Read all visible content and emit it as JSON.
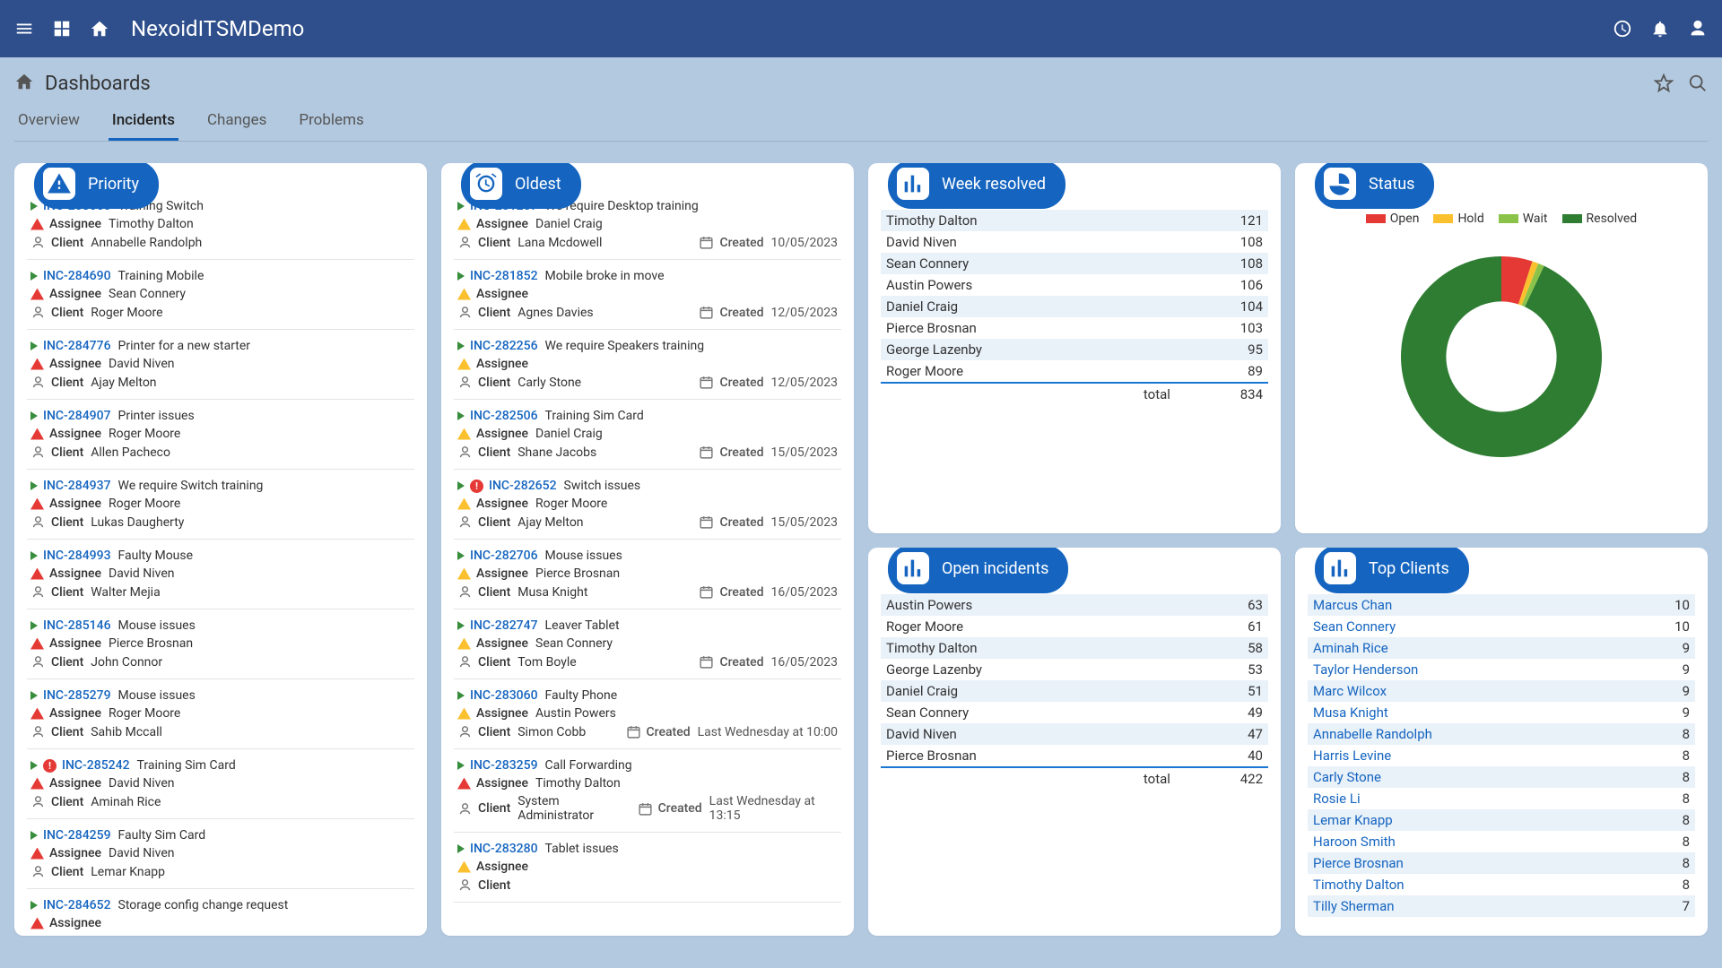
{
  "header": {
    "app_title": "NexoidITSMDemo"
  },
  "subheader": {
    "page_title": "Dashboards"
  },
  "tabs": [
    {
      "label": "Overview",
      "active": false
    },
    {
      "label": "Incidents",
      "active": true
    },
    {
      "label": "Changes",
      "active": false
    },
    {
      "label": "Problems",
      "active": false
    }
  ],
  "cards": {
    "priority": {
      "title": "Priority",
      "items": [
        {
          "id": "INC-283650",
          "title": "Training Switch",
          "assignee": "Timothy Dalton",
          "assignee_sev": "red",
          "client": "Annabelle Randolph"
        },
        {
          "id": "INC-284690",
          "title": "Training Mobile",
          "assignee": "Sean Connery",
          "assignee_sev": "red",
          "client": "Roger Moore"
        },
        {
          "id": "INC-284776",
          "title": "Printer for a new starter",
          "assignee": "David Niven",
          "assignee_sev": "red",
          "client": "Ajay Melton"
        },
        {
          "id": "INC-284907",
          "title": "Printer issues",
          "assignee": "Roger Moore",
          "assignee_sev": "red",
          "client": "Allen Pacheco"
        },
        {
          "id": "INC-284937",
          "title": "We require Switch training",
          "assignee": "Roger Moore",
          "assignee_sev": "red",
          "client": "Lukas Daugherty"
        },
        {
          "id": "INC-284993",
          "title": "Faulty Mouse",
          "assignee": "David Niven",
          "assignee_sev": "red",
          "client": "Walter Mejia"
        },
        {
          "id": "INC-285146",
          "title": "Mouse issues",
          "assignee": "Pierce  Brosnan",
          "assignee_sev": "red",
          "client": "John Connor"
        },
        {
          "id": "INC-285279",
          "title": "Mouse issues",
          "assignee": "Roger Moore",
          "assignee_sev": "red",
          "client": "Sahib Mccall"
        },
        {
          "id": "INC-285242",
          "title": "Training Sim Card",
          "flag": true,
          "assignee": "David Niven",
          "assignee_sev": "red",
          "client": "Aminah Rice"
        },
        {
          "id": "INC-284259",
          "title": "Faulty Sim Card",
          "assignee": "David Niven",
          "assignee_sev": "red",
          "client": "Lemar Knapp"
        },
        {
          "id": "INC-284652",
          "title": "Storage config change request",
          "assignee": "",
          "assignee_sev": "red",
          "client": ""
        }
      ]
    },
    "oldest": {
      "title": "Oldest",
      "created_label": "Created",
      "items": [
        {
          "id": "INC-281287",
          "title": "We require Desktop training",
          "assignee": "Daniel Craig",
          "assignee_sev": "amber",
          "client": "Lana Mcdowell",
          "created": "10/05/2023"
        },
        {
          "id": "INC-281852",
          "title": "Mobile broke in move",
          "assignee": "",
          "assignee_sev": "amber",
          "client": "Agnes Davies",
          "created": "12/05/2023"
        },
        {
          "id": "INC-282256",
          "title": "We require Speakers training",
          "assignee": "",
          "assignee_sev": "amber",
          "client": "Carly Stone",
          "created": "12/05/2023"
        },
        {
          "id": "INC-282506",
          "title": "Training Sim Card",
          "assignee": "Daniel Craig",
          "assignee_sev": "amber",
          "client": "Shane Jacobs",
          "created": "15/05/2023"
        },
        {
          "id": "INC-282652",
          "title": "Switch issues",
          "flag": true,
          "assignee": "Roger Moore",
          "assignee_sev": "amber",
          "client": "Ajay Melton",
          "created": "15/05/2023"
        },
        {
          "id": "INC-282706",
          "title": "Mouse issues",
          "assignee": "Pierce  Brosnan",
          "assignee_sev": "amber",
          "client": "Musa Knight",
          "created": "16/05/2023"
        },
        {
          "id": "INC-282747",
          "title": "Leaver Tablet",
          "assignee": "Sean Connery",
          "assignee_sev": "amber",
          "client": "Tom Boyle",
          "created": "16/05/2023"
        },
        {
          "id": "INC-283060",
          "title": "Faulty Phone",
          "assignee": "Austin Powers",
          "assignee_sev": "amber",
          "client": "Simon Cobb",
          "created": "Last Wednesday at 10:00"
        },
        {
          "id": "INC-283259",
          "title": "Call Forwarding",
          "assignee": "Timothy Dalton",
          "assignee_sev": "red",
          "client": "System Administrator",
          "created": "Last Wednesday at 13:15"
        },
        {
          "id": "INC-283280",
          "title": "Tablet issues",
          "assignee": "",
          "assignee_sev": "amber",
          "client": "",
          "created": ""
        }
      ]
    },
    "week_resolved": {
      "title": "Week resolved",
      "rows": [
        {
          "name": "Timothy Dalton",
          "value": 121
        },
        {
          "name": "David Niven",
          "value": 108
        },
        {
          "name": "Sean Connery",
          "value": 108
        },
        {
          "name": "Austin Powers",
          "value": 106
        },
        {
          "name": "Daniel Craig",
          "value": 104
        },
        {
          "name": "Pierce Brosnan",
          "value": 103
        },
        {
          "name": "George Lazenby",
          "value": 95
        },
        {
          "name": "Roger Moore",
          "value": 89
        }
      ],
      "total_label": "total",
      "total": 834
    },
    "status": {
      "title": "Status",
      "legend": [
        {
          "label": "Open",
          "color": "#e53935"
        },
        {
          "label": "Hold",
          "color": "#fbc02d"
        },
        {
          "label": "Wait",
          "color": "#8bc34a"
        },
        {
          "label": "Resolved",
          "color": "#2e7d32"
        }
      ]
    },
    "open_incidents": {
      "title": "Open incidents",
      "rows": [
        {
          "name": "Austin Powers",
          "value": 63
        },
        {
          "name": "Roger Moore",
          "value": 61
        },
        {
          "name": "Timothy Dalton",
          "value": 58
        },
        {
          "name": "George Lazenby",
          "value": 53
        },
        {
          "name": "Daniel Craig",
          "value": 51
        },
        {
          "name": "Sean Connery",
          "value": 49
        },
        {
          "name": "David Niven",
          "value": 47
        },
        {
          "name": "Pierce Brosnan",
          "value": 40
        }
      ],
      "total_label": "total",
      "total": 422
    },
    "top_clients": {
      "title": "Top Clients",
      "rows": [
        {
          "name": "Marcus Chan",
          "value": 10
        },
        {
          "name": "Sean Connery",
          "value": 10
        },
        {
          "name": "Aminah Rice",
          "value": 9
        },
        {
          "name": "Taylor Henderson",
          "value": 9
        },
        {
          "name": "Marc Wilcox",
          "value": 9
        },
        {
          "name": "Musa Knight",
          "value": 9
        },
        {
          "name": "Annabelle Randolph",
          "value": 8
        },
        {
          "name": "Harris Levine",
          "value": 8
        },
        {
          "name": "Carly Stone",
          "value": 8
        },
        {
          "name": "Rosie Li",
          "value": 8
        },
        {
          "name": "Lemar Knapp",
          "value": 8
        },
        {
          "name": "Haroon Smith",
          "value": 8
        },
        {
          "name": "Pierce Brosnan",
          "value": 8
        },
        {
          "name": "Timothy Dalton",
          "value": 8
        },
        {
          "name": "Tilly Sherman",
          "value": 7
        }
      ]
    }
  },
  "labels": {
    "assignee": "Assignee",
    "client": "Client"
  },
  "chart_data": {
    "type": "pie",
    "series": [
      {
        "name": "Open",
        "value": 5,
        "color": "#e53935"
      },
      {
        "name": "Hold",
        "value": 1,
        "color": "#fbc02d"
      },
      {
        "name": "Wait",
        "value": 1,
        "color": "#8bc34a"
      },
      {
        "name": "Resolved",
        "value": 93,
        "color": "#2e7d32"
      }
    ]
  }
}
